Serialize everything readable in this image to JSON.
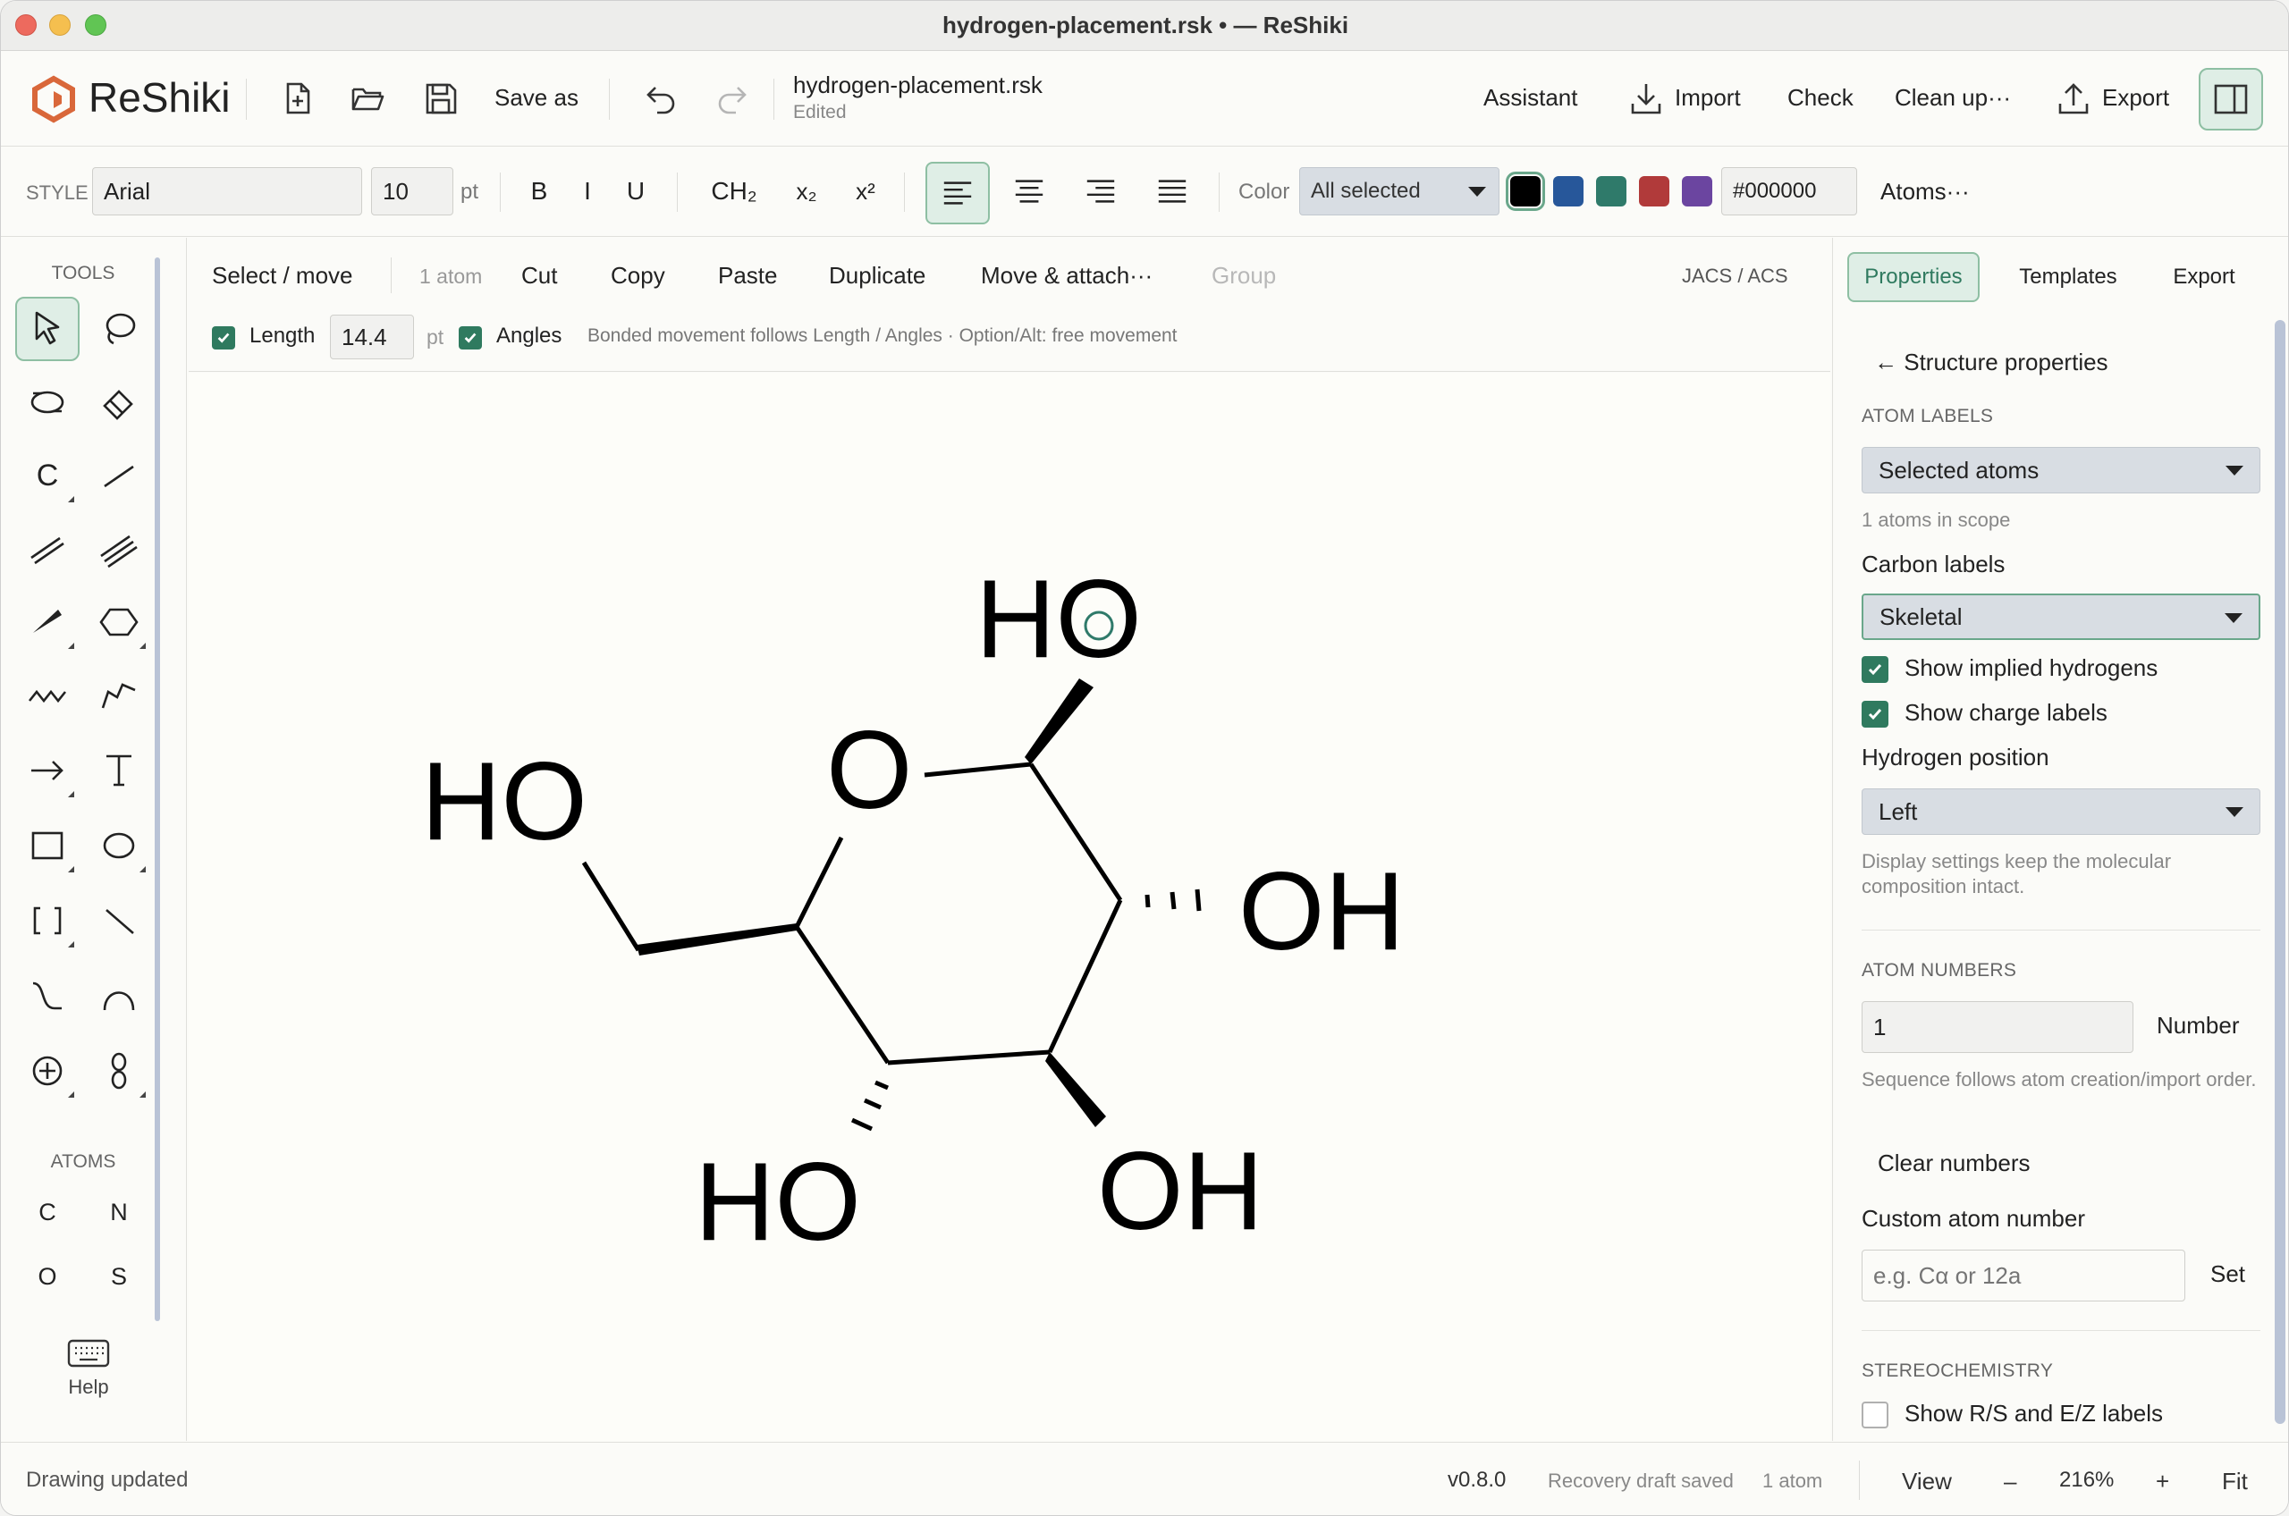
{
  "window": {
    "title": "hydrogen-placement.rsk • — ReShiki"
  },
  "header": {
    "brand": "ReShiki",
    "save_as": "Save as",
    "document_name": "hydrogen-placement.rsk",
    "document_status": "Edited",
    "assistant": "Assistant",
    "import": "Import",
    "check": "Check",
    "clean_up": "Clean up···",
    "export": "Export"
  },
  "style": {
    "label": "STYLE",
    "font": "Arial",
    "size": "10",
    "size_unit": "pt",
    "bold": "B",
    "italic": "I",
    "underline": "U",
    "ch2": "CH₂",
    "subscript": "x₂",
    "superscript": "x²",
    "color_label": "Color",
    "color_scope": "All selected",
    "hex": "#000000",
    "atoms_menu": "Atoms···",
    "swatches": [
      "#000000",
      "#27579a",
      "#2f7a6a",
      "#b13a3a",
      "#6b45a0"
    ]
  },
  "tools": {
    "title": "TOOLS",
    "carbon_tool": "C",
    "atoms_title": "ATOMS",
    "atoms": [
      "C",
      "N",
      "O",
      "S"
    ],
    "help": "Help"
  },
  "context": {
    "select_move": "Select / move",
    "count": "1 atom",
    "cut": "Cut",
    "copy": "Copy",
    "paste": "Paste",
    "duplicate": "Duplicate",
    "move_attach": "Move & attach···",
    "group": "Group",
    "style_preset": "JACS / ACS",
    "length_label": "Length",
    "length_value": "14.4",
    "length_unit": "pt",
    "angles_label": "Angles",
    "hint": "Bonded movement follows Length / Angles · Option/Alt: free movement"
  },
  "canvas": {
    "labels": {
      "o_ring": "O",
      "ho_top": "HO",
      "ho_left": "HO",
      "oh_right": "OH",
      "oh_bottom": "OH",
      "ho_bottom": "HO"
    }
  },
  "right_panel": {
    "tabs": [
      "Properties",
      "Templates",
      "Export"
    ],
    "back": "← Structure properties",
    "atom_labels_head": "ATOM LABELS",
    "scope_select": "Selected atoms",
    "scope_note": "1 atoms in scope",
    "carbon_labels": "Carbon labels",
    "carbon_select": "Skeletal",
    "show_implied_h": "Show implied hydrogens",
    "show_charge": "Show charge labels",
    "h_position": "Hydrogen position",
    "h_position_select": "Left",
    "display_note": "Display settings keep the molecular composition intact.",
    "atom_numbers_head": "ATOM NUMBERS",
    "number_value": "1",
    "number_button": "Number",
    "sequence_note": "Sequence follows atom creation/import order.",
    "clear_numbers": "Clear numbers",
    "custom_number": "Custom atom number",
    "custom_placeholder": "e.g. Cα or 12a",
    "set_button": "Set",
    "stereo_head": "STEREOCHEMISTRY",
    "show_rs": "Show R/S and E/Z labels"
  },
  "status": {
    "message": "Drawing updated",
    "version": "v0.8.0",
    "recovery": "Recovery draft saved",
    "count": "1 atom",
    "view": "View",
    "zoom_out": "–",
    "zoom": "216%",
    "zoom_in": "+",
    "fit": "Fit"
  }
}
